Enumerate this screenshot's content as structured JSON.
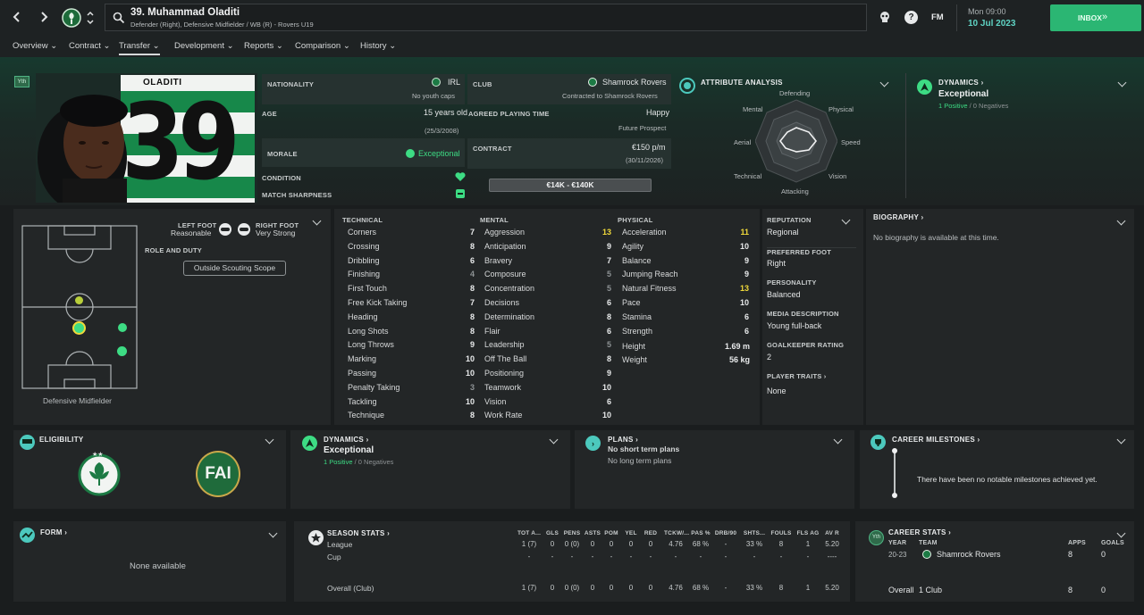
{
  "header": {
    "title": "39. Muhammad Oladiti",
    "subtitle": "Defender (Right), Defensive Midfielder / WB (R) - Rovers U19",
    "date_day": "Mon 09:00",
    "date": "10 Jul 2023",
    "inbox_label": "INBOX",
    "fm_label": "FM"
  },
  "tabs": [
    "Overview",
    "Contract",
    "Transfer",
    "Development",
    "Reports",
    "Comparison",
    "History"
  ],
  "player": {
    "youth_badge": "Yth",
    "shirt_name": "OLADITI",
    "shirt_number": "39"
  },
  "info": {
    "nationality_label": "NATIONALITY",
    "nationality": "IRL",
    "youth_caps": "No youth caps",
    "age_label": "AGE",
    "age": "15 years old",
    "dob": "(25/3/2008)",
    "morale_label": "MORALE",
    "morale": "Exceptional",
    "condition_label": "CONDITION",
    "sharpness_label": "MATCH SHARPNESS",
    "club_label": "CLUB",
    "club": "Shamrock Rovers",
    "club_contract": "Contracted to Shamrock Rovers",
    "playing_time_label": "AGREED PLAYING TIME",
    "playing_time": "Happy",
    "playing_time_sub": "Future Prospect",
    "contract_label": "CONTRACT",
    "wage": "€150 p/m",
    "contract_end": "(30/11/2026)",
    "value_range": "€14K - €140K"
  },
  "attribute_analysis": {
    "title": "ATTRIBUTE ANALYSIS",
    "labels": [
      "Defending",
      "Physical",
      "Speed",
      "Vision",
      "Attacking",
      "Technical",
      "Aerial",
      "Mental"
    ]
  },
  "dynamics_top": {
    "title": "DYNAMICS",
    "value": "Exceptional",
    "positive": "1 Positive",
    "negatives": "0 Negatives"
  },
  "position_panel": {
    "left_foot_label": "LEFT FOOT",
    "left_foot": "Reasonable",
    "right_foot_label": "RIGHT FOOT",
    "right_foot": "Very Strong",
    "role_label": "ROLE AND DUTY",
    "scouting_btn": "Outside Scouting Scope",
    "position_name": "Defensive Midfielder"
  },
  "technical": {
    "title": "TECHNICAL",
    "rows": [
      {
        "name": "Corners",
        "value": "7"
      },
      {
        "name": "Crossing",
        "value": "8"
      },
      {
        "name": "Dribbling",
        "value": "6"
      },
      {
        "name": "Finishing",
        "value": "4"
      },
      {
        "name": "First Touch",
        "value": "8"
      },
      {
        "name": "Free Kick Taking",
        "value": "7"
      },
      {
        "name": "Heading",
        "value": "8"
      },
      {
        "name": "Long Shots",
        "value": "8"
      },
      {
        "name": "Long Throws",
        "value": "9"
      },
      {
        "name": "Marking",
        "value": "10"
      },
      {
        "name": "Passing",
        "value": "10"
      },
      {
        "name": "Penalty Taking",
        "value": "3"
      },
      {
        "name": "Tackling",
        "value": "10"
      },
      {
        "name": "Technique",
        "value": "8"
      }
    ]
  },
  "mental": {
    "title": "MENTAL",
    "rows": [
      {
        "name": "Aggression",
        "value": "13"
      },
      {
        "name": "Anticipation",
        "value": "9"
      },
      {
        "name": "Bravery",
        "value": "7"
      },
      {
        "name": "Composure",
        "value": "5"
      },
      {
        "name": "Concentration",
        "value": "5"
      },
      {
        "name": "Decisions",
        "value": "6"
      },
      {
        "name": "Determination",
        "value": "8"
      },
      {
        "name": "Flair",
        "value": "6"
      },
      {
        "name": "Leadership",
        "value": "5"
      },
      {
        "name": "Off The Ball",
        "value": "8"
      },
      {
        "name": "Positioning",
        "value": "9"
      },
      {
        "name": "Teamwork",
        "value": "10"
      },
      {
        "name": "Vision",
        "value": "6"
      },
      {
        "name": "Work Rate",
        "value": "10"
      }
    ]
  },
  "physical": {
    "title": "PHYSICAL",
    "rows": [
      {
        "name": "Acceleration",
        "value": "11"
      },
      {
        "name": "Agility",
        "value": "10"
      },
      {
        "name": "Balance",
        "value": "9"
      },
      {
        "name": "Jumping Reach",
        "value": "9"
      },
      {
        "name": "Natural Fitness",
        "value": "13"
      },
      {
        "name": "Pace",
        "value": "10"
      },
      {
        "name": "Stamina",
        "value": "6"
      },
      {
        "name": "Strength",
        "value": "6"
      }
    ],
    "height_label": "Height",
    "height": "1.69 m",
    "weight_label": "Weight",
    "weight": "56 kg"
  },
  "profile": {
    "reputation_label": "REPUTATION",
    "reputation": "Regional",
    "pref_foot_label": "PREFERRED FOOT",
    "pref_foot": "Right",
    "personality_label": "PERSONALITY",
    "personality": "Balanced",
    "media_label": "MEDIA DESCRIPTION",
    "media": "Young full-back",
    "gk_label": "GOALKEEPER RATING",
    "gk": "2",
    "traits_label": "PLAYER TRAITS",
    "traits": "None"
  },
  "biography": {
    "title": "BIOGRAPHY",
    "text": "No biography is available at this time."
  },
  "eligibility": {
    "title": "ELIGIBILITY",
    "fai_text": "FAI"
  },
  "dynamics_mid": {
    "title": "DYNAMICS",
    "value": "Exceptional",
    "positive": "1 Positive",
    "negatives": "0 Negatives"
  },
  "plans": {
    "title": "PLANS",
    "short": "No short term plans",
    "long": "No long term plans"
  },
  "milestones": {
    "title": "CAREER MILESTONES",
    "text": "There have been no notable milestones achieved yet."
  },
  "form": {
    "title": "FORM",
    "text": "None available"
  },
  "season_stats": {
    "title": "SEASON STATS",
    "columns": [
      "TOT A...",
      "GLS",
      "PENS",
      "ASTS",
      "POM",
      "YEL",
      "RED",
      "TCKW/...",
      "PAS %",
      "DRB/90",
      "SHTS...",
      "FOULS",
      "FLS AG",
      "AV R"
    ],
    "rows": [
      {
        "label": "League",
        "cells": [
          "1 (7)",
          "0",
          "0 (0)",
          "0",
          "0",
          "0",
          "0",
          "4.76",
          "68 %",
          "-",
          "33 %",
          "8",
          "1",
          "5.20"
        ]
      },
      {
        "label": "Cup",
        "cells": [
          "-",
          "-",
          "-",
          "-",
          "-",
          "-",
          "-",
          "-",
          "-",
          "-",
          "-",
          "-",
          "-",
          "----"
        ]
      },
      {
        "label": "Overall (Club)",
        "cells": [
          "1 (7)",
          "0",
          "0 (0)",
          "0",
          "0",
          "0",
          "0",
          "4.76",
          "68 %",
          "-",
          "33 %",
          "8",
          "1",
          "5.20"
        ]
      }
    ]
  },
  "career_stats": {
    "title": "CAREER STATS",
    "year_label": "YEAR",
    "team_label": "TEAM",
    "apps_label": "APPS",
    "goals_label": "GOALS",
    "rows": [
      {
        "year": "20-23",
        "team": "Shamrock Rovers",
        "apps": "8",
        "goals": "0"
      }
    ],
    "overall_label": "Overall",
    "overall_clubs": "1 Club",
    "overall_apps": "8",
    "overall_goals": "0"
  },
  "colors": {
    "accent": "#3ddc84",
    "teal": "#5fd3c3",
    "highlight": "#f0d93a",
    "inbox": "#2bb673"
  }
}
